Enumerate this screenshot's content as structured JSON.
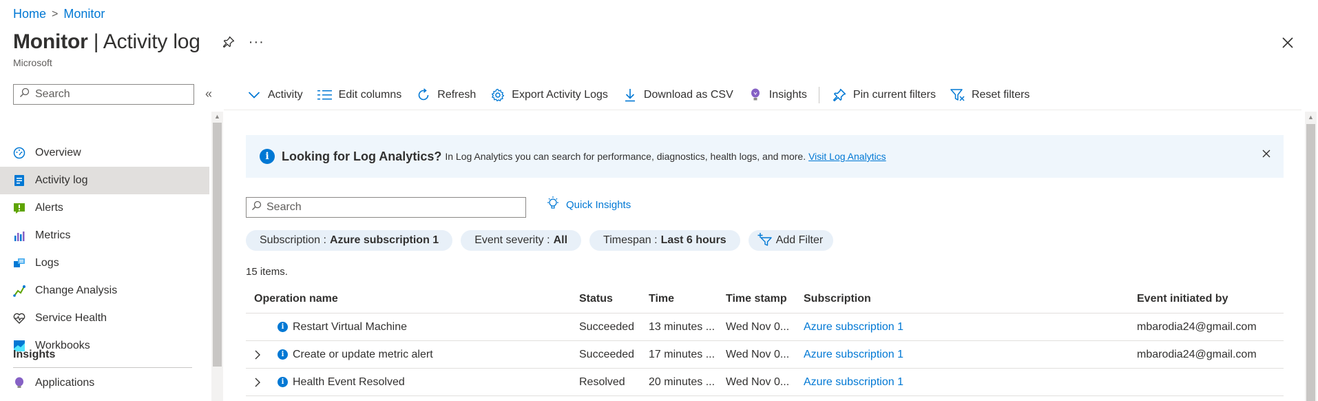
{
  "breadcrumb": {
    "home": "Home",
    "separator": ">",
    "current": "Monitor"
  },
  "header": {
    "title_main": "Monitor",
    "title_sep": " | ",
    "title_sub": "Activity log",
    "more": "···",
    "subtitle": "Microsoft"
  },
  "sidebar": {
    "search_placeholder": "Search",
    "collapse": "«",
    "items": [
      {
        "label": "Overview",
        "icon": "overview-gauge-icon"
      },
      {
        "label": "Activity log",
        "icon": "activity-log-icon",
        "active": true
      },
      {
        "label": "Alerts",
        "icon": "alerts-icon"
      },
      {
        "label": "Metrics",
        "icon": "metrics-icon"
      },
      {
        "label": "Logs",
        "icon": "logs-icon"
      },
      {
        "label": "Change Analysis",
        "icon": "change-analysis-icon"
      },
      {
        "label": "Service Health",
        "icon": "service-health-icon"
      },
      {
        "label": "Workbooks",
        "icon": "workbooks-icon"
      }
    ],
    "section_insights": "Insights",
    "insights_items": [
      {
        "label": "Applications",
        "icon": "applications-bulb-icon"
      }
    ]
  },
  "toolbar": {
    "activity": "Activity",
    "edit_columns": "Edit columns",
    "refresh": "Refresh",
    "export": "Export Activity Logs",
    "download": "Download as CSV",
    "insights": "Insights",
    "pin_filters": "Pin current filters",
    "reset_filters": "Reset filters"
  },
  "banner": {
    "heading": "Looking for Log Analytics?",
    "text": "In Log Analytics you can search for performance, diagnostics, health logs, and more.",
    "link": "Visit Log Analytics"
  },
  "search": {
    "placeholder": "Search"
  },
  "quick_insights": "Quick Insights",
  "filters": [
    {
      "label": "Subscription :",
      "value": "Azure subscription 1"
    },
    {
      "label": "Event severity :",
      "value": "All"
    },
    {
      "label": "Timespan :",
      "value": "Last 6 hours"
    }
  ],
  "add_filter": "Add Filter",
  "items_count": "15 items.",
  "table": {
    "columns": [
      "Operation name",
      "Status",
      "Time",
      "Time stamp",
      "Subscription",
      "Event initiated by"
    ],
    "rows": [
      {
        "expandable": false,
        "operation": "Restart Virtual Machine",
        "status": "Succeeded",
        "time": "13 minutes ...",
        "timestamp": "Wed Nov 0...",
        "subscription": "Azure subscription 1",
        "initiated_by": "mbarodia24@gmail.com"
      },
      {
        "expandable": true,
        "operation": "Create or update metric alert",
        "status": "Succeeded",
        "time": "17 minutes ...",
        "timestamp": "Wed Nov 0...",
        "subscription": "Azure subscription 1",
        "initiated_by": "mbarodia24@gmail.com"
      },
      {
        "expandable": true,
        "operation": "Health Event Resolved",
        "status": "Resolved",
        "time": "20 minutes ...",
        "timestamp": "Wed Nov 0...",
        "subscription": "Azure subscription 1",
        "initiated_by": ""
      }
    ]
  },
  "colors": {
    "accent": "#0078d4",
    "banner_bg": "#eff6fc",
    "pill_bg": "#e8f0f8",
    "active_nav": "#e1dfdd"
  }
}
